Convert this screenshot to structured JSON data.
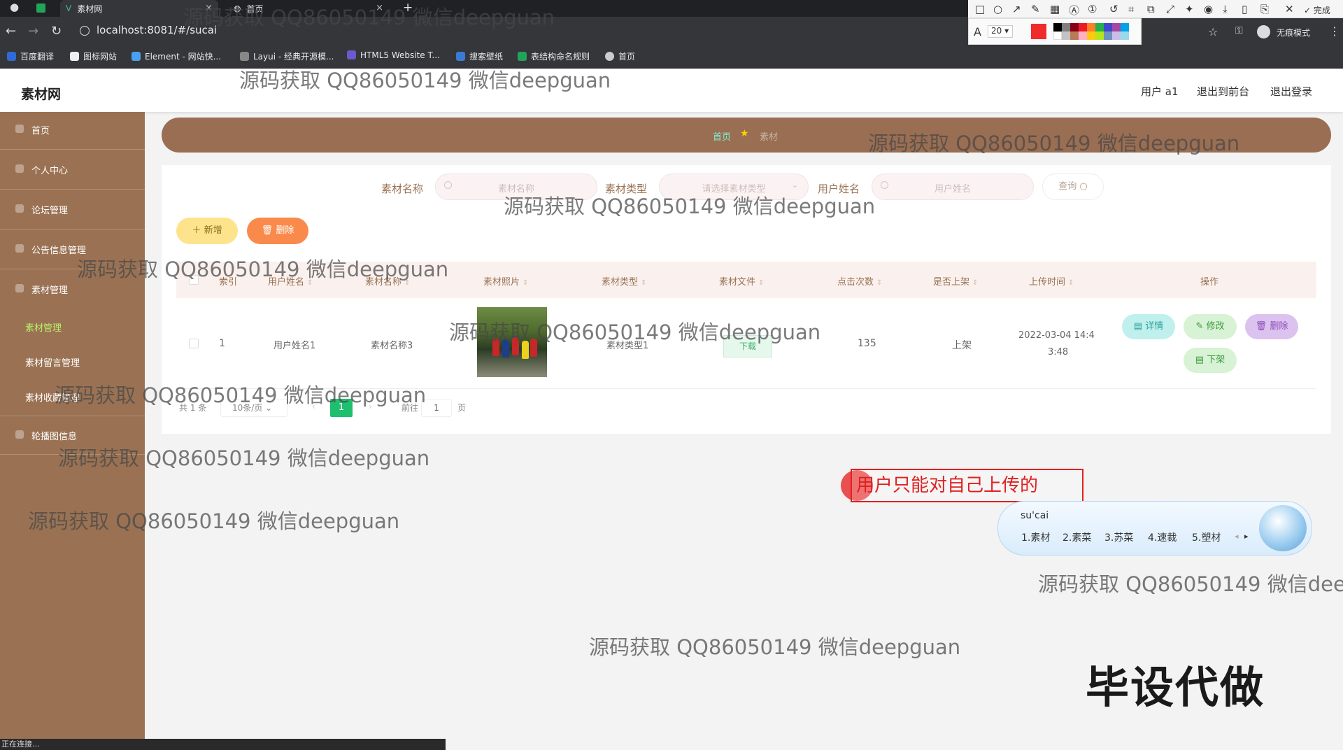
{
  "browser": {
    "tabs": [
      {
        "title": "素材网",
        "active": true
      },
      {
        "title": "首页",
        "active": false
      }
    ],
    "new_tab": "+",
    "close_glyph": "×",
    "url": "localhost:8081/#/sucai",
    "bookmarks": [
      "百度翻译",
      "图标网站",
      "Element - 网站快...",
      "Layui - 经典开源模...",
      "HTML5 Website T...",
      "搜索壁纸",
      "表结构命名规则",
      "首页"
    ],
    "incognito_label": "无痕模式",
    "draw_toolbar": {
      "done_label": "完成",
      "font_size": "20",
      "font_glyph": "A"
    }
  },
  "app": {
    "brand": "素材网",
    "header_links": {
      "user": "用户 a1",
      "back_to_front": "退出到前台",
      "logout": "退出登录"
    },
    "sidebar": [
      {
        "label": "首页",
        "icon": "home-icon"
      },
      {
        "label": "个人中心",
        "icon": "user-icon"
      },
      {
        "label": "论坛管理",
        "icon": "forum-icon"
      },
      {
        "label": "公告信息管理",
        "icon": "notice-icon"
      },
      {
        "label": "素材管理",
        "icon": "folder-icon"
      },
      {
        "label": "轮播图信息",
        "icon": "image-icon"
      }
    ],
    "sidebar_sub": [
      {
        "label": "素材管理",
        "active": true
      },
      {
        "label": "素材留言管理",
        "active": false
      },
      {
        "label": "素材收藏管理",
        "active": false
      }
    ],
    "breadcrumb": {
      "home": "首页",
      "current": "素材"
    },
    "search": {
      "name_label": "素材名称",
      "name_placeholder": "素材名称",
      "type_label": "素材类型",
      "type_placeholder": "请选择素材类型",
      "user_label": "用户姓名",
      "user_placeholder": "用户姓名",
      "query_button": "查询"
    },
    "actions": {
      "add": "新增",
      "delete": "删除"
    },
    "table": {
      "headers": [
        "索引",
        "用户姓名",
        "素材名称",
        "素材照片",
        "素材类型",
        "素材文件",
        "点击次数",
        "是否上架",
        "上传时间",
        "操作"
      ],
      "rows": [
        {
          "index": "1",
          "user": "用户姓名1",
          "name": "素材名称3",
          "type": "素材类型1",
          "file_button": "下载",
          "clicks": "135",
          "on_shelf": "上架",
          "time_line1": "2022-03-04 14:4",
          "time_line2": "3:48",
          "ops": {
            "detail": "详情",
            "edit": "修改",
            "delete": "删除",
            "unlist": "下架"
          }
        }
      ]
    },
    "pagination": {
      "total": "共 1 条",
      "page_size": "10条/页",
      "current": "1",
      "goto_label": "前往",
      "goto_value": "1",
      "page_unit": "页"
    }
  },
  "overlay": {
    "watermark": "源码获取 QQ86050149 微信deepguan",
    "watermark_clipped": "源码获取 QQ86050149 微信dee",
    "annotation": "用户只能对自己上传的",
    "ime": {
      "input": "su'cai",
      "candidates": [
        "1.素材",
        "2.素菜",
        "3.苏菜",
        "4.速裁",
        "5.塑材"
      ]
    },
    "promo": "毕设代做",
    "status": "正在连接..."
  },
  "colors": {
    "sidebar": "#9a7253",
    "breadcrumb_bar": "#9a6e52",
    "accent_green": "#1fbf6f",
    "add_button": "#fde48c",
    "delete_button": "#f98a4c"
  }
}
